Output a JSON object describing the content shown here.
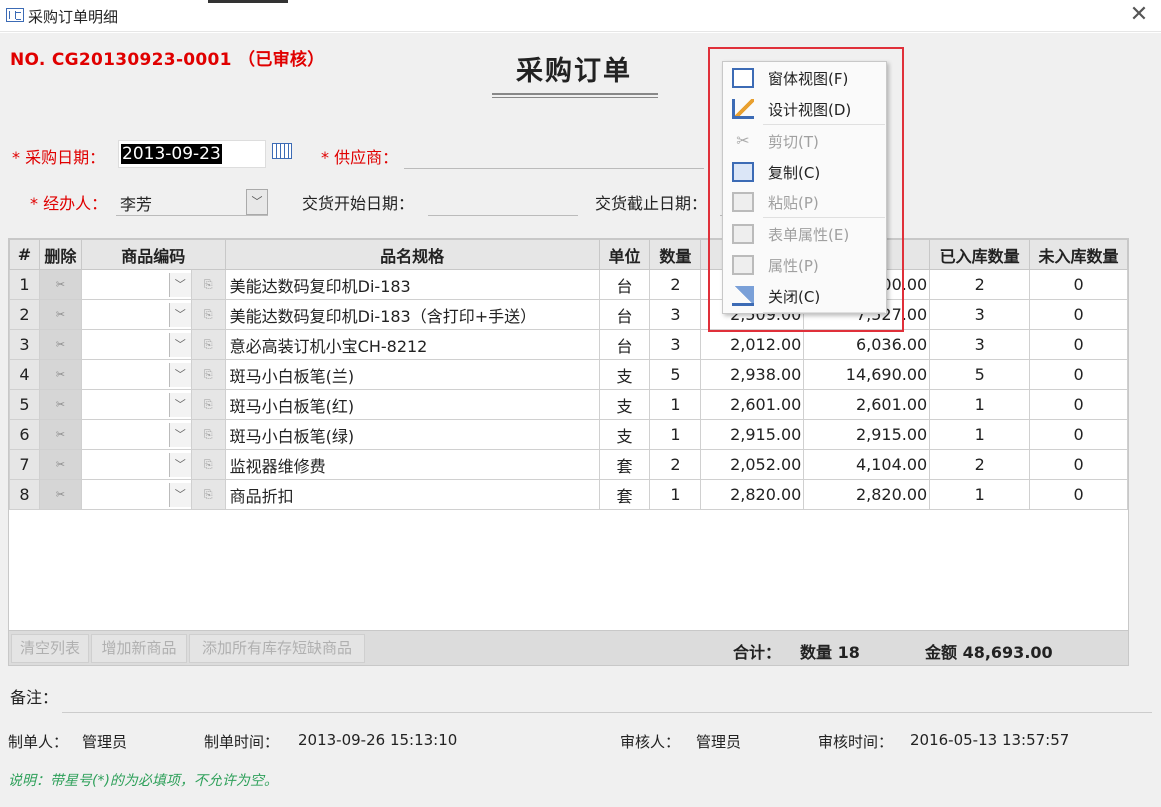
{
  "window": {
    "title": "采购订单明细",
    "close_glyph": "✕"
  },
  "header": {
    "order_no": "NO. CG20130923-0001 （已审核）",
    "form_title": "采购订单"
  },
  "fields": {
    "purchase_date_label": "* 采购日期：",
    "purchase_date_value": "2013-09-23",
    "supplier_label": "* 供应商：",
    "handler_label": "* 经办人：",
    "handler_value": "李芳",
    "delivery_start_label": "交货开始日期：",
    "delivery_end_label": "交货截止日期："
  },
  "grid": {
    "columns": [
      "#",
      "删除",
      "商品编码",
      "",
      "品名规格",
      "单位",
      "数量",
      "",
      "",
      "已入库数量",
      "未入库数量"
    ],
    "rows": [
      {
        "n": "1",
        "name": "美能达数码复印机Di-183",
        "unit": "台",
        "qty": "2",
        "price": "",
        "amount": "00.00",
        "in": "2",
        "out": "0"
      },
      {
        "n": "2",
        "name": "美能达数码复印机Di-183（含打印+手送）",
        "unit": "台",
        "qty": "3",
        "price": "2,509.00",
        "amount": "7,527.00",
        "in": "3",
        "out": "0"
      },
      {
        "n": "3",
        "name": "意必高装订机小宝CH-8212",
        "unit": "台",
        "qty": "3",
        "price": "2,012.00",
        "amount": "6,036.00",
        "in": "3",
        "out": "0"
      },
      {
        "n": "4",
        "name": "斑马小白板笔(兰)",
        "unit": "支",
        "qty": "5",
        "price": "2,938.00",
        "amount": "14,690.00",
        "in": "5",
        "out": "0"
      },
      {
        "n": "5",
        "name": "斑马小白板笔(红)",
        "unit": "支",
        "qty": "1",
        "price": "2,601.00",
        "amount": "2,601.00",
        "in": "1",
        "out": "0"
      },
      {
        "n": "6",
        "name": "斑马小白板笔(绿)",
        "unit": "支",
        "qty": "1",
        "price": "2,915.00",
        "amount": "2,915.00",
        "in": "1",
        "out": "0"
      },
      {
        "n": "7",
        "name": "监视器维修费",
        "unit": "套",
        "qty": "2",
        "price": "2,052.00",
        "amount": "4,104.00",
        "in": "2",
        "out": "0"
      },
      {
        "n": "8",
        "name": "商品折扣",
        "unit": "套",
        "qty": "1",
        "price": "2,820.00",
        "amount": "2,820.00",
        "in": "1",
        "out": "0"
      }
    ]
  },
  "footer_buttons": {
    "clear": "清空列表",
    "add": "增加新商品",
    "add_short": "添加所有库存短缺商品"
  },
  "totals": {
    "sum_label": "合计：",
    "qty_label": "数量  18",
    "amount_label": "金额   48,693.00"
  },
  "remark": {
    "label": "备注："
  },
  "meta": {
    "creator_label": "制单人：",
    "creator": "管理员",
    "created_time_label": "制单时间：",
    "created_time": "2013-09-26 15:13:10",
    "auditor_label": "审核人：",
    "auditor": "管理员",
    "audit_time_label": "审核时间：",
    "audit_time": "2016-05-13 13:57:57"
  },
  "note": "说明：带星号(*)的为必填项，不允许为空。",
  "context_menu": {
    "items": [
      {
        "label": "窗体视图(F)",
        "icon": "form-view-icon",
        "enabled": true
      },
      {
        "label": "设计视图(D)",
        "icon": "design-view-icon",
        "enabled": true
      },
      {
        "label": "剪切(T)",
        "icon": "cut-icon",
        "enabled": false
      },
      {
        "label": "复制(C)",
        "icon": "copy-icon",
        "enabled": true
      },
      {
        "label": "粘贴(P)",
        "icon": "paste-icon",
        "enabled": false
      },
      {
        "label": "表单属性(E)",
        "icon": "form-properties-icon",
        "enabled": false
      },
      {
        "label": "属性(P)",
        "icon": "properties-icon",
        "enabled": false
      },
      {
        "label": "关闭(C)",
        "icon": "close-form-icon",
        "enabled": true
      }
    ]
  },
  "colors": {
    "required": "#e00000",
    "note": "#2ea05a",
    "highlight": "#e0303a"
  }
}
